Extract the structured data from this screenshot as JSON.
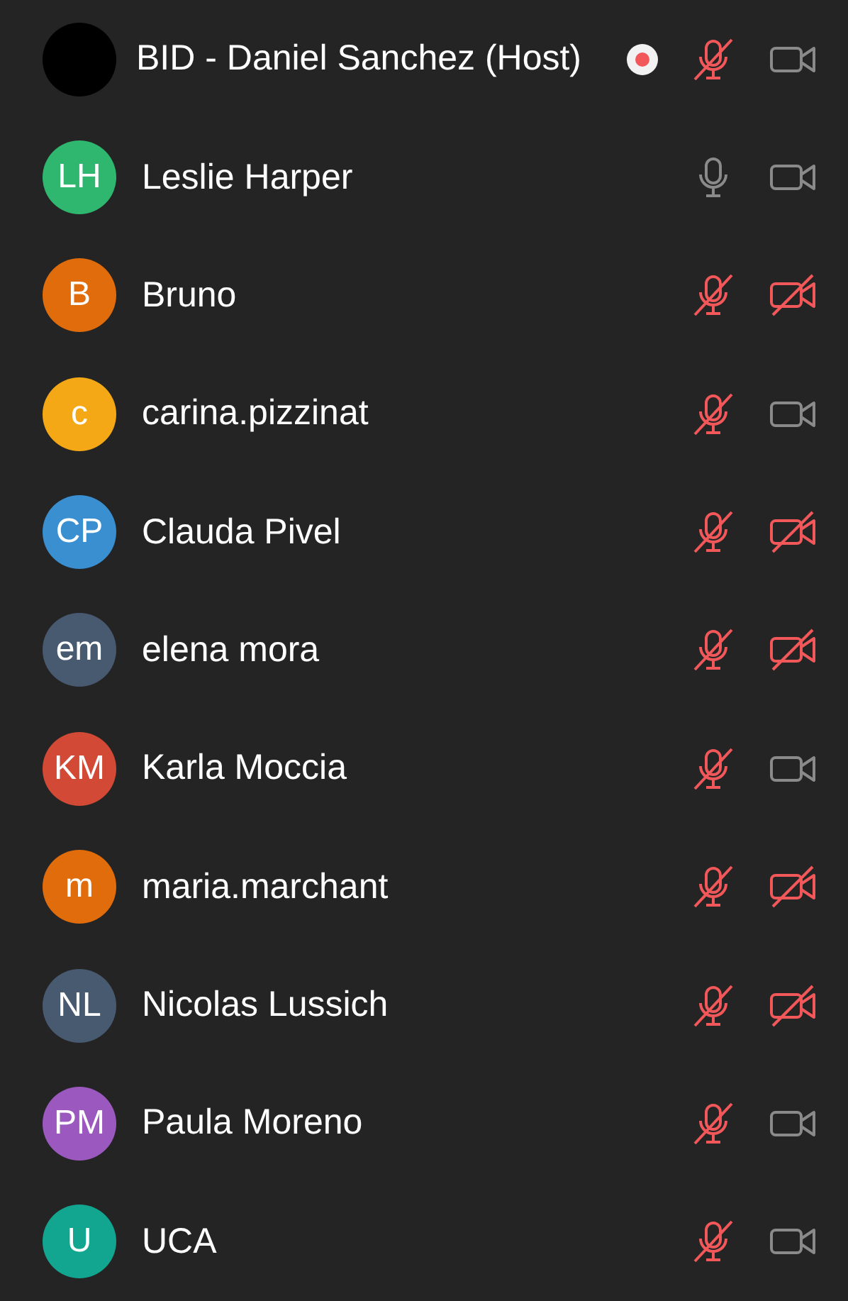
{
  "participants": [
    {
      "name": "BID - Daniel Sanchez (Host)",
      "color": "#000000",
      "recording": true,
      "muted": true,
      "video_off": false
    },
    {
      "name": "Leslie Harper",
      "initials": "LH",
      "color": "#2fb66f",
      "recording": false,
      "muted": false,
      "video_off": false
    },
    {
      "name": "Bruno",
      "initials": "B",
      "color": "#e06c0c",
      "recording": false,
      "muted": true,
      "video_off": true
    },
    {
      "name": "carina.pizzinat",
      "initials": "c",
      "color": "#f5a815",
      "recording": false,
      "muted": true,
      "video_off": false
    },
    {
      "name": "Clauda Pivel",
      "initials": "CP",
      "color": "#3a8fd0",
      "recording": false,
      "muted": true,
      "video_off": true
    },
    {
      "name": "elena mora",
      "initials": "em",
      "color": "#485a70",
      "recording": false,
      "muted": true,
      "video_off": true
    },
    {
      "name": "Karla Moccia",
      "initials": "KM",
      "color": "#d24a35",
      "recording": false,
      "muted": true,
      "video_off": false
    },
    {
      "name": "maria.marchant",
      "initials": "m",
      "color": "#e06c0c",
      "recording": false,
      "muted": true,
      "video_off": true
    },
    {
      "name": "Nicolas Lussich",
      "initials": "NL",
      "color": "#485a70",
      "recording": false,
      "muted": true,
      "video_off": true
    },
    {
      "name": "Paula Moreno",
      "initials": "PM",
      "color": "#9b59c0",
      "recording": false,
      "muted": true,
      "video_off": false
    },
    {
      "name": "UCA",
      "initials": "U",
      "color": "#12a58f",
      "recording": false,
      "muted": true,
      "video_off": false
    }
  ]
}
